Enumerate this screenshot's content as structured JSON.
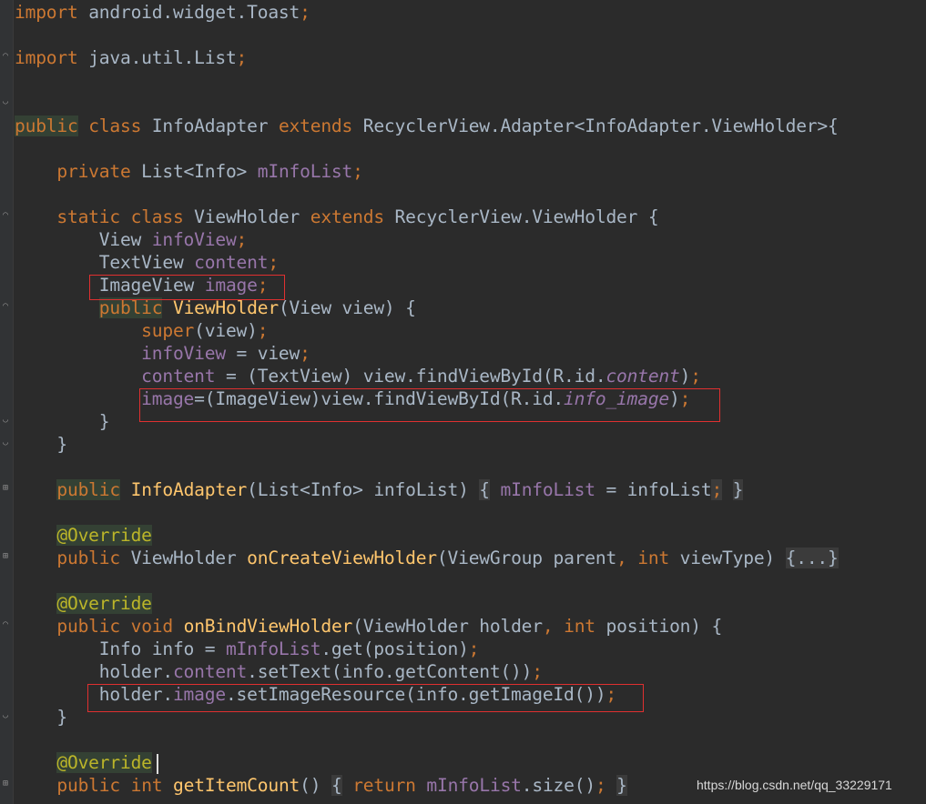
{
  "editor": {
    "lines": [
      [
        {
          "t": "import",
          "c": "kw"
        },
        {
          "t": " android.widget.Toast"
        },
        {
          "t": ";",
          "c": "kw"
        }
      ],
      [],
      [
        {
          "t": "import",
          "c": "kw"
        },
        {
          "t": " java.util.List"
        },
        {
          "t": ";",
          "c": "kw"
        }
      ],
      [],
      [],
      [
        {
          "t": "public",
          "c": "kw hl"
        },
        {
          "t": " "
        },
        {
          "t": "class",
          "c": "kw"
        },
        {
          "t": " InfoAdapter "
        },
        {
          "t": "extends",
          "c": "kw"
        },
        {
          "t": " RecyclerView.Adapter<InfoAdapter.ViewHolder>{"
        }
      ],
      [],
      [
        {
          "t": "    "
        },
        {
          "t": "private",
          "c": "kw"
        },
        {
          "t": " List<Info> "
        },
        {
          "t": "mInfoList",
          "c": "fld"
        },
        {
          "t": ";",
          "c": "kw"
        }
      ],
      [],
      [
        {
          "t": "    "
        },
        {
          "t": "static",
          "c": "kw"
        },
        {
          "t": " "
        },
        {
          "t": "class",
          "c": "kw"
        },
        {
          "t": " ViewHolder "
        },
        {
          "t": "extends",
          "c": "kw"
        },
        {
          "t": " RecyclerView.ViewHolder {"
        }
      ],
      [
        {
          "t": "        View "
        },
        {
          "t": "infoView",
          "c": "fld"
        },
        {
          "t": ";",
          "c": "kw"
        }
      ],
      [
        {
          "t": "        TextView "
        },
        {
          "t": "content",
          "c": "fld"
        },
        {
          "t": ";",
          "c": "kw"
        }
      ],
      [
        {
          "t": "        ImageView "
        },
        {
          "t": "image",
          "c": "fld"
        },
        {
          "t": ";",
          "c": "kw"
        }
      ],
      [
        {
          "t": "        "
        },
        {
          "t": "public",
          "c": "kw hl"
        },
        {
          "t": " "
        },
        {
          "t": "ViewHolder",
          "c": "meth"
        },
        {
          "t": "(View view) {"
        }
      ],
      [
        {
          "t": "            "
        },
        {
          "t": "super",
          "c": "kw"
        },
        {
          "t": "(view)"
        },
        {
          "t": ";",
          "c": "kw"
        }
      ],
      [
        {
          "t": "            "
        },
        {
          "t": "infoView",
          "c": "fld"
        },
        {
          "t": " = view"
        },
        {
          "t": ";",
          "c": "kw"
        }
      ],
      [
        {
          "t": "            "
        },
        {
          "t": "content",
          "c": "fld"
        },
        {
          "t": " = (TextView) view.findViewById(R.id."
        },
        {
          "t": "content",
          "c": "fld ital"
        },
        {
          "t": ")"
        },
        {
          "t": ";",
          "c": "kw"
        }
      ],
      [
        {
          "t": "            "
        },
        {
          "t": "image",
          "c": "fld"
        },
        {
          "t": "=(ImageView)view.findViewById(R.id."
        },
        {
          "t": "info_image",
          "c": "fld ital"
        },
        {
          "t": ")"
        },
        {
          "t": ";",
          "c": "kw"
        }
      ],
      [
        {
          "t": "        }"
        }
      ],
      [
        {
          "t": "    }"
        }
      ],
      [],
      [
        {
          "t": "    "
        },
        {
          "t": "public",
          "c": "kw hl"
        },
        {
          "t": " "
        },
        {
          "t": "InfoAdapter",
          "c": "meth"
        },
        {
          "t": "(List<Info> infoList) "
        },
        {
          "t": "{",
          "c": "fb"
        },
        {
          "t": " "
        },
        {
          "t": "mInfoList",
          "c": "fld"
        },
        {
          "t": " = infoList"
        },
        {
          "t": ";",
          "c": "kw fb"
        },
        {
          "t": " "
        },
        {
          "t": "}",
          "c": "fb"
        }
      ],
      [],
      [
        {
          "t": "    "
        },
        {
          "t": "@Override",
          "c": "ann hl"
        }
      ],
      [
        {
          "t": "    "
        },
        {
          "t": "public",
          "c": "kw"
        },
        {
          "t": " ViewHolder "
        },
        {
          "t": "onCreateViewHolder",
          "c": "meth"
        },
        {
          "t": "(ViewGroup parent"
        },
        {
          "t": ",",
          "c": "kw"
        },
        {
          "t": " "
        },
        {
          "t": "int",
          "c": "kw"
        },
        {
          "t": " viewType) "
        },
        {
          "t": "{...}",
          "c": "fb"
        }
      ],
      [],
      [
        {
          "t": "    "
        },
        {
          "t": "@Override",
          "c": "ann hl"
        }
      ],
      [
        {
          "t": "    "
        },
        {
          "t": "public",
          "c": "kw"
        },
        {
          "t": " "
        },
        {
          "t": "void",
          "c": "kw"
        },
        {
          "t": " "
        },
        {
          "t": "onBindViewHolder",
          "c": "meth"
        },
        {
          "t": "(ViewHolder holder"
        },
        {
          "t": ",",
          "c": "kw"
        },
        {
          "t": " "
        },
        {
          "t": "int",
          "c": "kw"
        },
        {
          "t": " position) {"
        }
      ],
      [
        {
          "t": "        Info info = "
        },
        {
          "t": "mInfoList",
          "c": "fld"
        },
        {
          "t": ".get(position)"
        },
        {
          "t": ";",
          "c": "kw"
        }
      ],
      [
        {
          "t": "        holder."
        },
        {
          "t": "content",
          "c": "fld"
        },
        {
          "t": ".setText(info.getContent())"
        },
        {
          "t": ";",
          "c": "kw"
        }
      ],
      [
        {
          "t": "        holder."
        },
        {
          "t": "image",
          "c": "fld"
        },
        {
          "t": ".setImageResource(info.getImageId())"
        },
        {
          "t": ";",
          "c": "kw"
        }
      ],
      [
        {
          "t": "    }"
        }
      ],
      [],
      [
        {
          "t": "    "
        },
        {
          "t": "@Override",
          "c": "ann hl"
        }
      ],
      [
        {
          "t": "    "
        },
        {
          "t": "public",
          "c": "kw"
        },
        {
          "t": " "
        },
        {
          "t": "int",
          "c": "kw"
        },
        {
          "t": " "
        },
        {
          "t": "getItemCount",
          "c": "meth"
        },
        {
          "t": "() "
        },
        {
          "t": "{",
          "c": "fb"
        },
        {
          "t": " "
        },
        {
          "t": "return",
          "c": "kw"
        },
        {
          "t": " "
        },
        {
          "t": "mInfoList",
          "c": "fld"
        },
        {
          "t": ".size()"
        },
        {
          "t": ";",
          "c": "kw"
        },
        {
          "t": " "
        },
        {
          "t": "}",
          "c": "fb"
        }
      ]
    ]
  },
  "highlight_boxes": [
    "imageview-field-declaration",
    "image-findviewbyid-assignment",
    "set-image-resource-call"
  ],
  "gutter_icons": [
    "fold-marker-icon"
  ],
  "watermark": "https://blog.csdn.net/qq_33229171"
}
